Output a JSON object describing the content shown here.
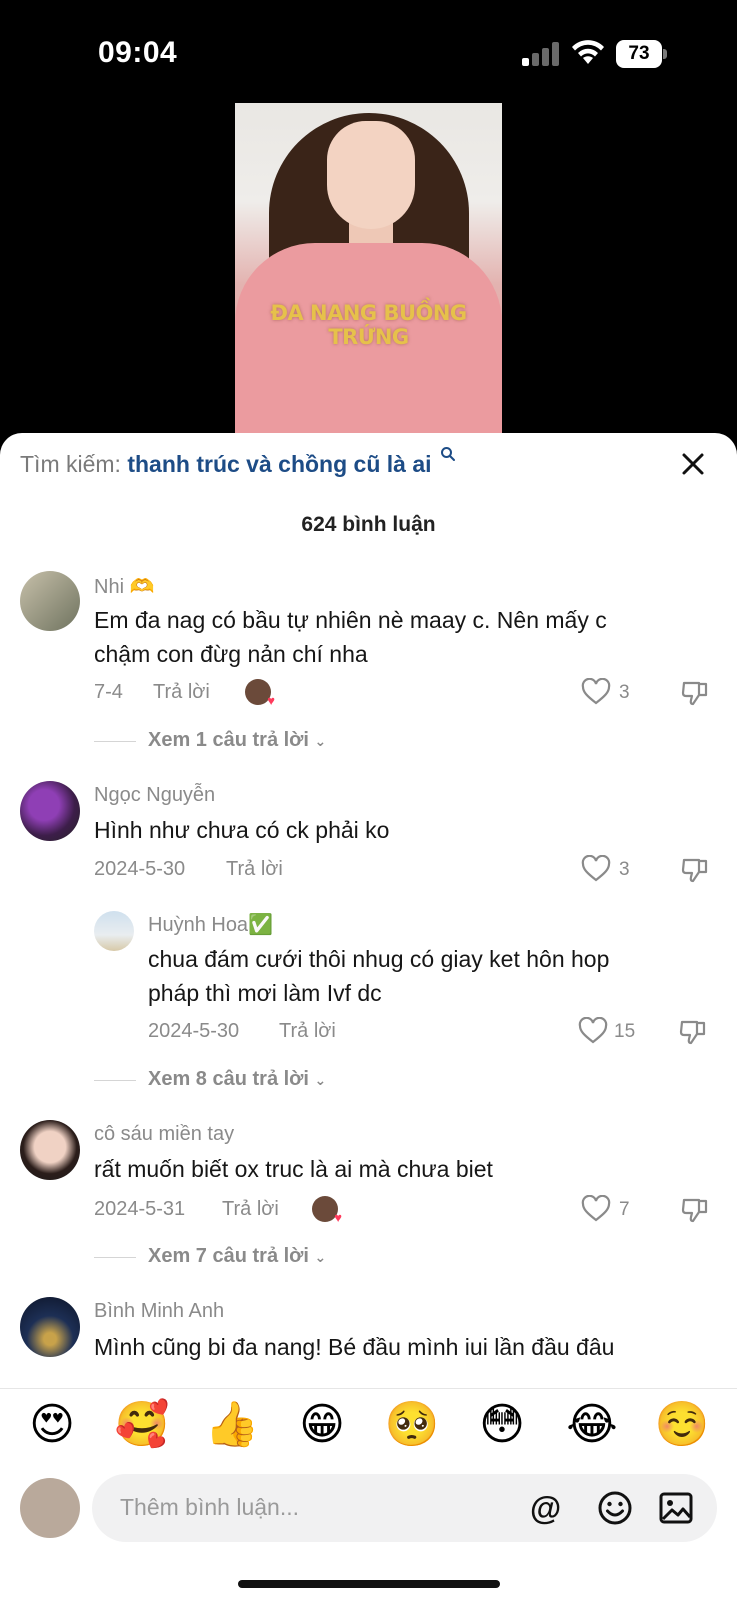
{
  "status_bar": {
    "time": "09:04",
    "battery": "73"
  },
  "video": {
    "caption": "ĐA NANG BUỒNG TRỨNG"
  },
  "search": {
    "prefix": "Tìm kiếm:",
    "term": "thanh trúc và chồng cũ là ai"
  },
  "comments_count_label": "624 bình luận",
  "comments": [
    {
      "user": "Nhi 🫶",
      "text_line1": "Em đa nag có bầu tự nhiên nè maay c. Nên mấy c",
      "text_line2": "chậm con đừg nản chí nha",
      "date": "7-4",
      "reply_label": "Trả lời",
      "likes": "3",
      "view_replies": "Xem 1 câu trả lời"
    },
    {
      "user": "Ngọc Nguyễn",
      "text_line1": "Hình như chưa có ck phải ko",
      "date": "2024-5-30",
      "reply_label": "Trả lời",
      "likes": "3"
    },
    {
      "user": "Huỳnh Hoa✅",
      "text_line1": "chua đám cưới thôi nhug có giay ket hôn hop",
      "text_line2": "pháp thì mơi làm Ivf dc",
      "date": "2024-5-30",
      "reply_label": "Trả lời",
      "likes": "15",
      "view_replies": "Xem 8 câu trả lời"
    },
    {
      "user": "cô sáu miền tay",
      "text_line1": "rất muốn biết ox truc là ai mà chưa biet",
      "date": "2024-5-31",
      "reply_label": "Trả lời",
      "likes": "7",
      "view_replies": "Xem 7 câu trả lời"
    },
    {
      "user": "Bình Minh Anh",
      "text_line1": "Mình cũng bi đa nang! Bé đầu mình iui lần đầu đâu"
    }
  ],
  "emoji_bar": [
    "😍",
    "🥰",
    "👍",
    "😁",
    "🥺",
    "😳",
    "😂",
    "☺️"
  ],
  "input": {
    "placeholder": "Thêm bình luận..."
  },
  "colors": {
    "accent": "#1d4c86",
    "like_badge": "#ff3b5c"
  }
}
